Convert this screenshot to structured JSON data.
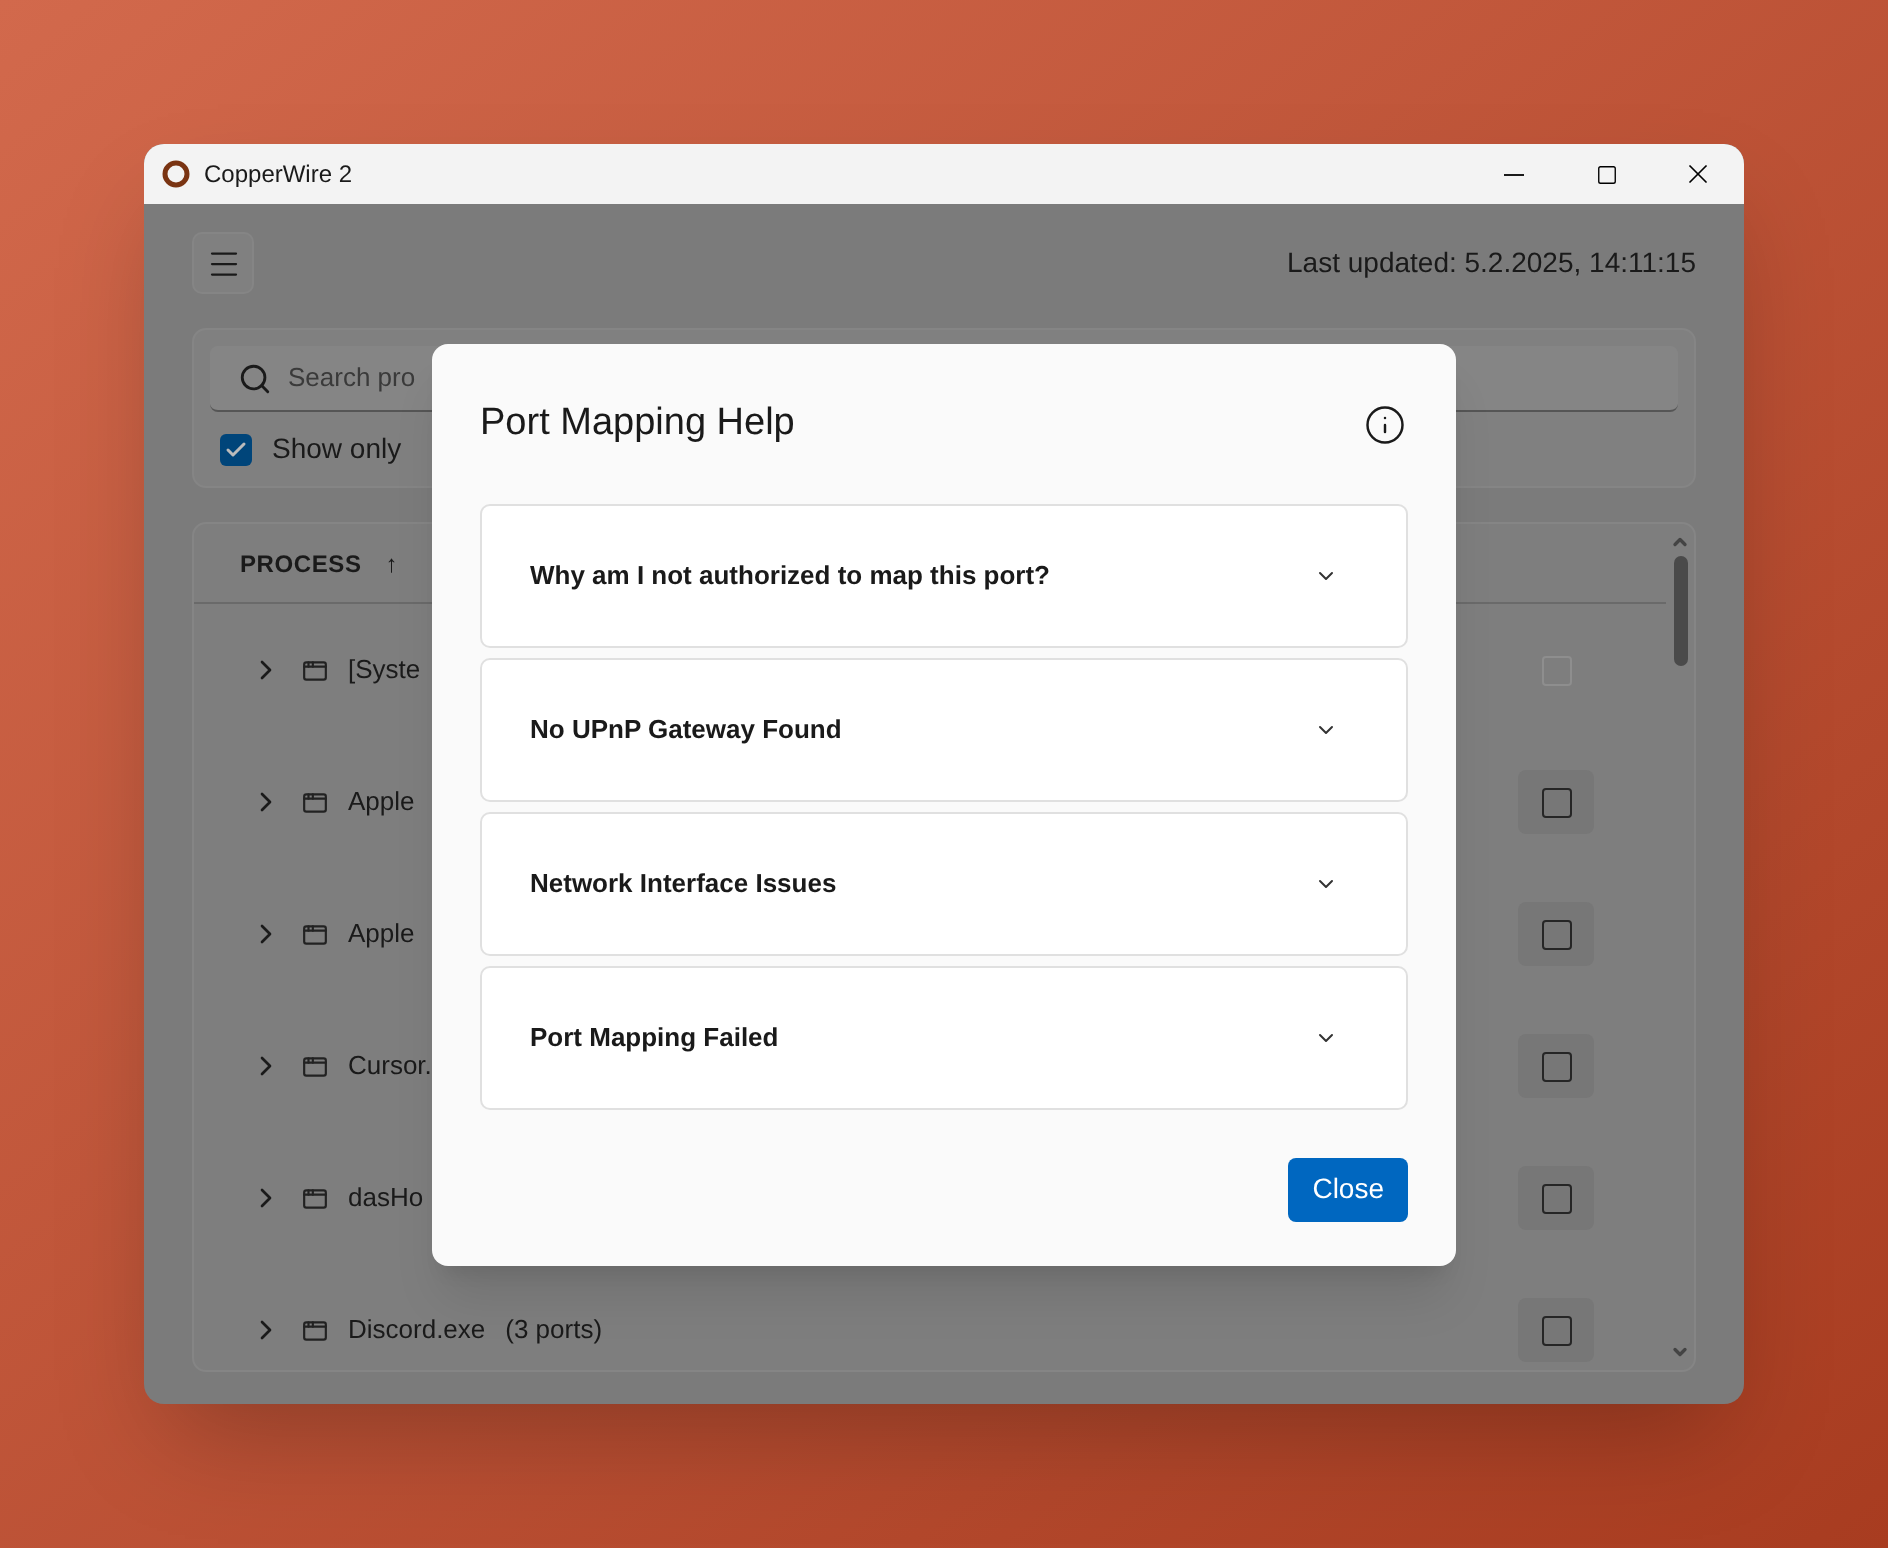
{
  "window": {
    "title": "CopperWire 2"
  },
  "header": {
    "last_updated": "Last updated: 5.2.2025, 14:11:15"
  },
  "search": {
    "placeholder": "Search pro"
  },
  "filter": {
    "label": "Show only",
    "checked": true
  },
  "table": {
    "columns": [
      {
        "label": "PROCESS",
        "sort": "↑"
      }
    ],
    "rows": [
      {
        "name": "[Syste",
        "ports": "",
        "disabled": true
      },
      {
        "name": "Apple",
        "ports": "",
        "disabled": false
      },
      {
        "name": "Apple",
        "ports": "",
        "disabled": false
      },
      {
        "name": "Cursor.",
        "ports": "",
        "disabled": false
      },
      {
        "name": "dasHo",
        "ports": "",
        "disabled": false
      },
      {
        "name": "Discord.exe",
        "ports": "(3 ports)",
        "disabled": false
      }
    ]
  },
  "dialog": {
    "title": "Port Mapping Help",
    "items": [
      {
        "question": "Why am I not authorized to map this port?",
        "expanded": false
      },
      {
        "question": "No UPnP Gateway Found",
        "expanded": false
      },
      {
        "question": "Network Interface Issues",
        "expanded": false
      },
      {
        "question": "Port Mapping Failed",
        "expanded": false
      }
    ],
    "close": "Close"
  }
}
